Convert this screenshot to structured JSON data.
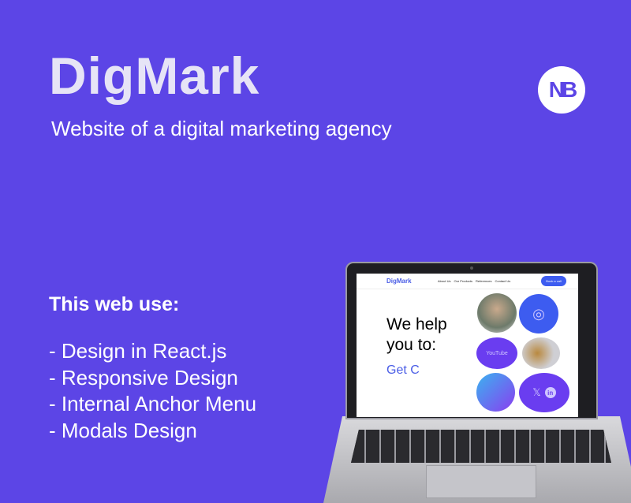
{
  "title": "DigMark",
  "subtitle": "Website of a digital marketing agency",
  "logo_text": "NB",
  "uses": {
    "heading": "This web use:",
    "items": [
      "- Design in React.js",
      "- Responsive Design",
      "- Internal Anchor Menu",
      "- Modals Design"
    ]
  },
  "mockup": {
    "brand": "DigMark",
    "nav": [
      "About Us",
      "Our Products",
      "References",
      "Contact Us"
    ],
    "cta": "Book a call",
    "hero": "We help you to:",
    "typed": "Get C",
    "youtube": "YouTube",
    "x": "𝕏",
    "linkedin": "in"
  },
  "colors": {
    "background": "#5c45e6",
    "accent": "#4a5de6"
  }
}
